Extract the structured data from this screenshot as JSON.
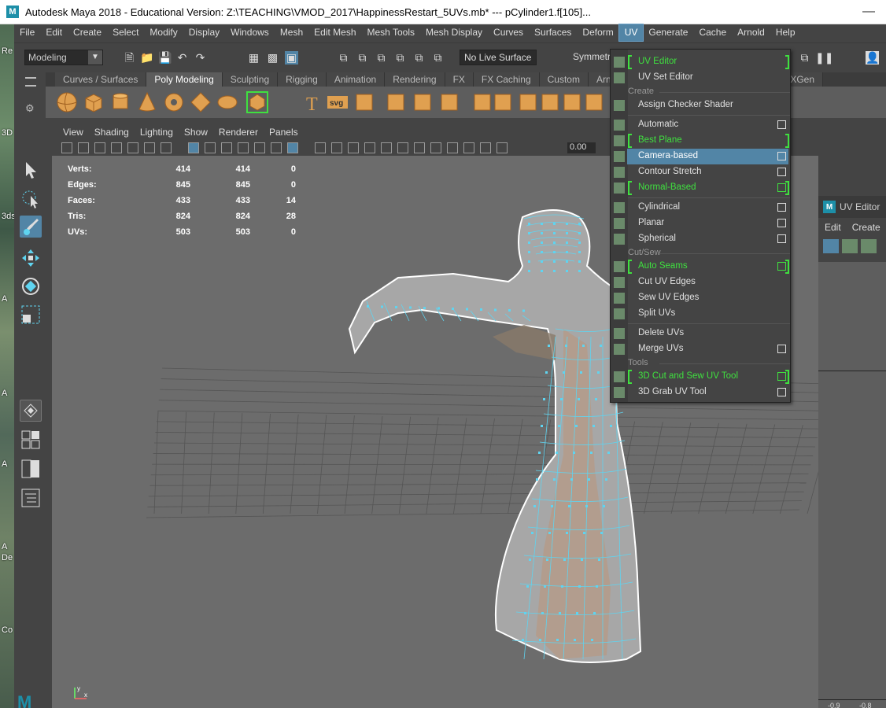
{
  "titlebar": {
    "text": "Autodesk Maya 2018 - Educational Version: Z:\\TEACHING\\VMOD_2017\\HappinessRestart_5UVs.mb*   ---   pCylinder1.f[105]...",
    "logo": "M"
  },
  "desktop": {
    "labels": [
      "Re",
      "3D",
      "3ds",
      "A",
      "A",
      "A",
      "A",
      "A",
      "De",
      "Co"
    ]
  },
  "menubar": [
    "File",
    "Edit",
    "Create",
    "Select",
    "Modify",
    "Display",
    "Windows",
    "Mesh",
    "Edit Mesh",
    "Mesh Tools",
    "Mesh Display",
    "Curves",
    "Surfaces",
    "Deform",
    "UV",
    "Generate",
    "Cache",
    "Arnold",
    "Help"
  ],
  "statusline": {
    "mode": "Modeling",
    "live_surface": "No Live Surface",
    "symmetry": "Symmetr"
  },
  "shelf_tabs": [
    "Curves / Surfaces",
    "Poly Modeling",
    "Sculpting",
    "Rigging",
    "Animation",
    "Rendering",
    "FX",
    "FX Caching",
    "Custom",
    "Arno",
    "XGen"
  ],
  "shelf_active": "Poly Modeling",
  "viewport_menu": [
    "View",
    "Shading",
    "Lighting",
    "Show",
    "Renderer",
    "Panels"
  ],
  "viewport_tool_value": "0.00",
  "hud": [
    {
      "label": "Verts:",
      "a": "414",
      "b": "414",
      "c": "0"
    },
    {
      "label": "Edges:",
      "a": "845",
      "b": "845",
      "c": "0"
    },
    {
      "label": "Faces:",
      "a": "433",
      "b": "433",
      "c": "14"
    },
    {
      "label": "Tris:",
      "a": "824",
      "b": "824",
      "c": "28"
    },
    {
      "label": "UVs:",
      "a": "503",
      "b": "503",
      "c": "0"
    }
  ],
  "uv_menu": {
    "items": [
      {
        "label": "UV Editor",
        "green": true
      },
      {
        "label": "UV Set Editor"
      },
      {
        "section": "Create"
      },
      {
        "label": "Assign Checker Shader"
      },
      {
        "label": "Automatic",
        "option": true
      },
      {
        "label": "Best Plane",
        "green": true
      },
      {
        "label": "Camera-based",
        "option": true,
        "highlight": true
      },
      {
        "label": "Contour Stretch",
        "option": true
      },
      {
        "label": "Normal-Based",
        "green": true,
        "option": true
      },
      {
        "label": "Cylindrical",
        "option": true
      },
      {
        "label": "Planar",
        "option": true
      },
      {
        "label": "Spherical",
        "option": true
      },
      {
        "section": "Cut/Sew"
      },
      {
        "label": "Auto Seams",
        "green": true,
        "option": true
      },
      {
        "label": "Cut UV Edges"
      },
      {
        "label": "Sew UV Edges"
      },
      {
        "label": "Split UVs"
      },
      {
        "label": "Delete UVs"
      },
      {
        "label": "Merge UVs",
        "option": true
      },
      {
        "section": "Tools"
      },
      {
        "label": "3D Cut and Sew UV Tool",
        "green": true,
        "option": true
      },
      {
        "label": "3D Grab UV Tool",
        "option": true
      }
    ]
  },
  "uv_editor_panel": {
    "title": "UV Editor",
    "menus": [
      "Edit",
      "Create"
    ],
    "ruler": [
      "-0.9",
      "-0.8"
    ]
  },
  "axis_label": "y x",
  "colors": {
    "accent": "#5285a6",
    "green": "#3fe03f",
    "mesh": "#5fd4f0",
    "shelf_orange": "#e0a050"
  }
}
